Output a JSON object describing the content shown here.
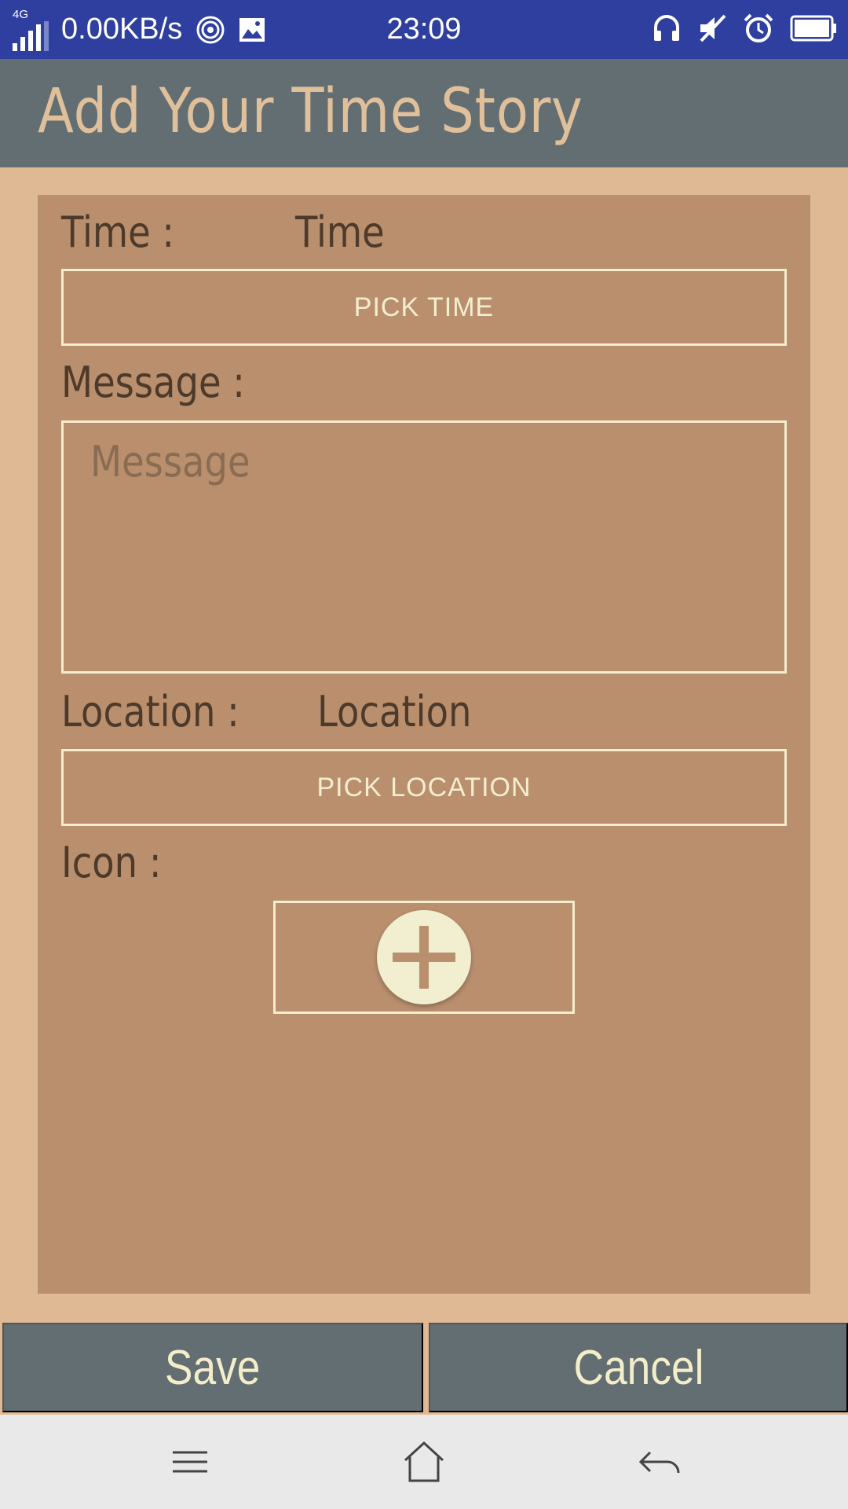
{
  "status_bar": {
    "network": "4G",
    "speed": "0.00KB/s",
    "time": "23:09",
    "icons": [
      "signal-icon",
      "hotspot-icon",
      "image-icon",
      "headset-icon",
      "mute-icon",
      "alarm-icon",
      "battery-icon"
    ]
  },
  "app": {
    "title": "Add Your Time Story"
  },
  "form": {
    "time_label": "Time :",
    "time_value": "Time",
    "pick_time_label": "PICK TIME",
    "message_label": "Message :",
    "message_placeholder": "Message",
    "message_value": "",
    "location_label": "Location :",
    "location_value": "Location",
    "pick_location_label": "PICK LOCATION",
    "icon_label": "Icon :",
    "add_icon": "add-icon"
  },
  "actions": {
    "save_label": "Save",
    "cancel_label": "Cancel"
  },
  "navigation": {
    "icons": [
      "menu-icon",
      "home-icon",
      "back-icon"
    ]
  },
  "colors": {
    "status_bar": "#2e3f9f",
    "toolbar": "#636e73",
    "page_background": "#dfb994",
    "card": "#b98f6d",
    "accent_text": "#e0c09a",
    "outline": "#f3eecb",
    "nav_bar": "#e9e9e9"
  }
}
